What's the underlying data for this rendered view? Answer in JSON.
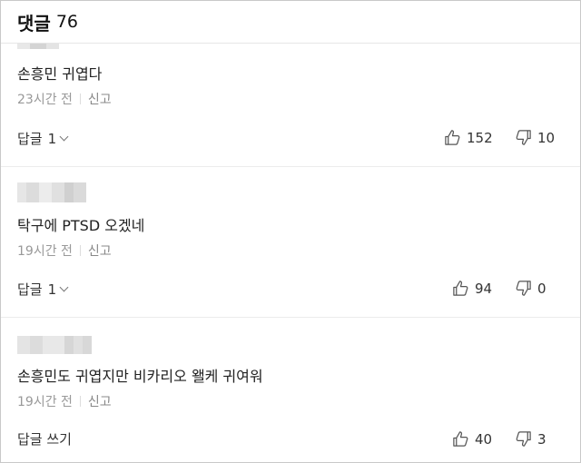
{
  "header": {
    "title": "댓글",
    "count": "76"
  },
  "comments": [
    {
      "text": "손흥민 귀엽다",
      "time": "23시간 전",
      "report": "신고",
      "reply_label": "답글",
      "reply_count": "1",
      "likes": "152",
      "dislikes": "10",
      "icons": {
        "like": "thumbs-up-icon",
        "dislike": "thumbs-down-icon",
        "expand": "chevron-down-icon"
      }
    },
    {
      "text": "탁구에 PTSD 오겠네",
      "time": "19시간 전",
      "report": "신고",
      "reply_label": "답글",
      "reply_count": "1",
      "likes": "94",
      "dislikes": "0"
    },
    {
      "text": "손흥민도 귀엽지만 비카리오 왤케 귀여워",
      "time": "19시간 전",
      "report": "신고",
      "reply_label": "답글 쓰기",
      "likes": "40",
      "dislikes": "3"
    }
  ],
  "colors": {
    "divider": "#ececec",
    "meta_text": "#999999",
    "blur": "#d8d8d8"
  }
}
